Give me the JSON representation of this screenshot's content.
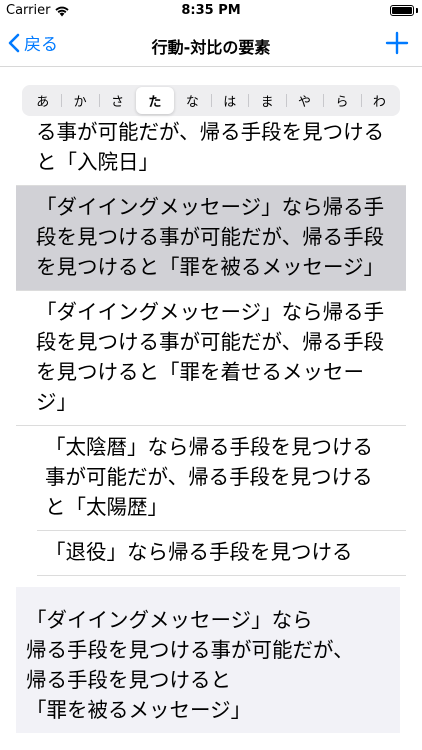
{
  "status": {
    "carrier": "Carrier",
    "time": "8:35 PM"
  },
  "nav": {
    "back_label": "戻る",
    "title": "行動-対比の要素"
  },
  "index": {
    "items": [
      "あ",
      "か",
      "さ",
      "た",
      "な",
      "は",
      "ま",
      "や",
      "ら",
      "わ"
    ],
    "selected": "た"
  },
  "rows": [
    {
      "text": "る事が可能だが、帰る手段を見つけると「入院日」",
      "selected": false
    },
    {
      "text": "「ダイイングメッセージ」なら帰る手段を見つける事が可能だが、帰る手段を見つけると「罪を被るメッセージ」",
      "selected": true
    },
    {
      "text": "「ダイイングメッセージ」なら帰る手段を見つける事が可能だが、帰る手段を見つけると「罪を着せるメッセージ」",
      "selected": false
    },
    {
      "text": "「太陰暦」なら帰る手段を見つける事が可能だが、帰る手段を見つけると「太陽歴」",
      "selected": false
    },
    {
      "text": "「退役」なら帰る手段を見つける",
      "selected": false
    }
  ],
  "detail": {
    "lines": [
      "「ダイイングメッセージ」なら",
      "帰る手段を見つける事が可能だが、",
      "帰る手段を見つけると",
      "「罪を被るメッセージ」"
    ]
  },
  "colors": {
    "accent": "#007aff",
    "selected_row": "#d1d1d6",
    "detail_bg": "#f2f2f7"
  },
  "icons": {
    "back": "chevron-left-icon",
    "add": "plus-icon",
    "wifi": "wifi-icon",
    "battery": "battery-icon"
  }
}
